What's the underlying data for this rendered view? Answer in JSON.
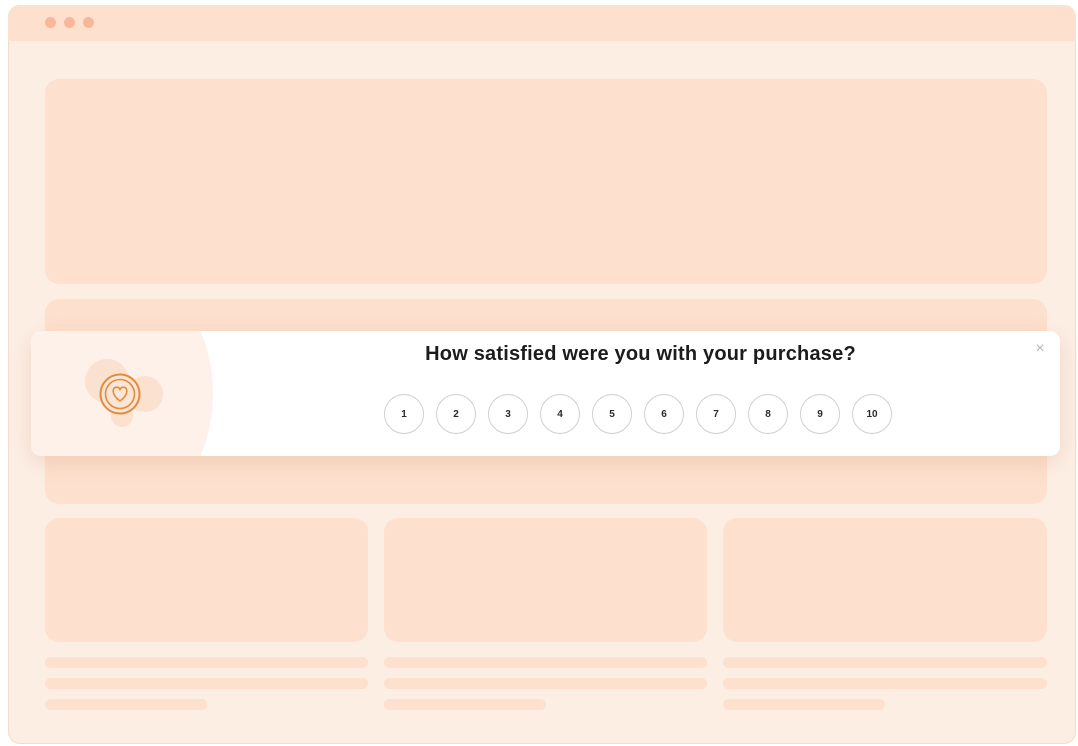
{
  "survey": {
    "question": "How satisfied were you with your purchase?",
    "close_symbol": "×",
    "icon": "heart-icon",
    "scale": [
      "1",
      "2",
      "3",
      "4",
      "5",
      "6",
      "7",
      "8",
      "9",
      "10"
    ]
  },
  "colors": {
    "page_background": "#fdeee4",
    "placeholder": "#fde0cd",
    "accent": "#e48b3d",
    "window_dots": "#f9b79a"
  }
}
